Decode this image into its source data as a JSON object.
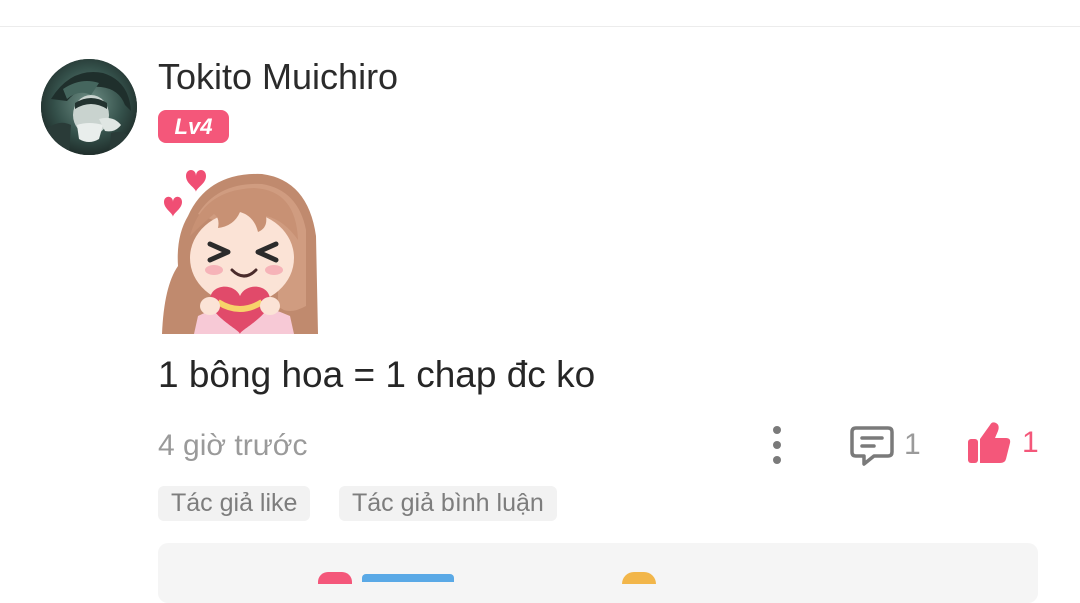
{
  "comment": {
    "author": {
      "name": "Tokito Muichiro",
      "level_badge": "Lv4",
      "avatar_icon": "user-avatar"
    },
    "sticker_icon": "heart-chocolate-girl-sticker",
    "text": "1 bông hoa = 1 chap đc ko",
    "time_ago": "4 giờ trước",
    "actions": {
      "more_icon": "more-vertical-icon",
      "reply_icon": "comment-bubble-icon",
      "reply_count": "1",
      "like_icon": "thumbs-up-icon",
      "like_count": "1"
    },
    "tags": [
      "Tác giả like",
      "Tác giả bình luận"
    ]
  },
  "colors": {
    "accent": "#f4577a",
    "muted_text": "#9a9a9a",
    "tag_background": "#f2f2f2",
    "divider": "#ececec"
  }
}
